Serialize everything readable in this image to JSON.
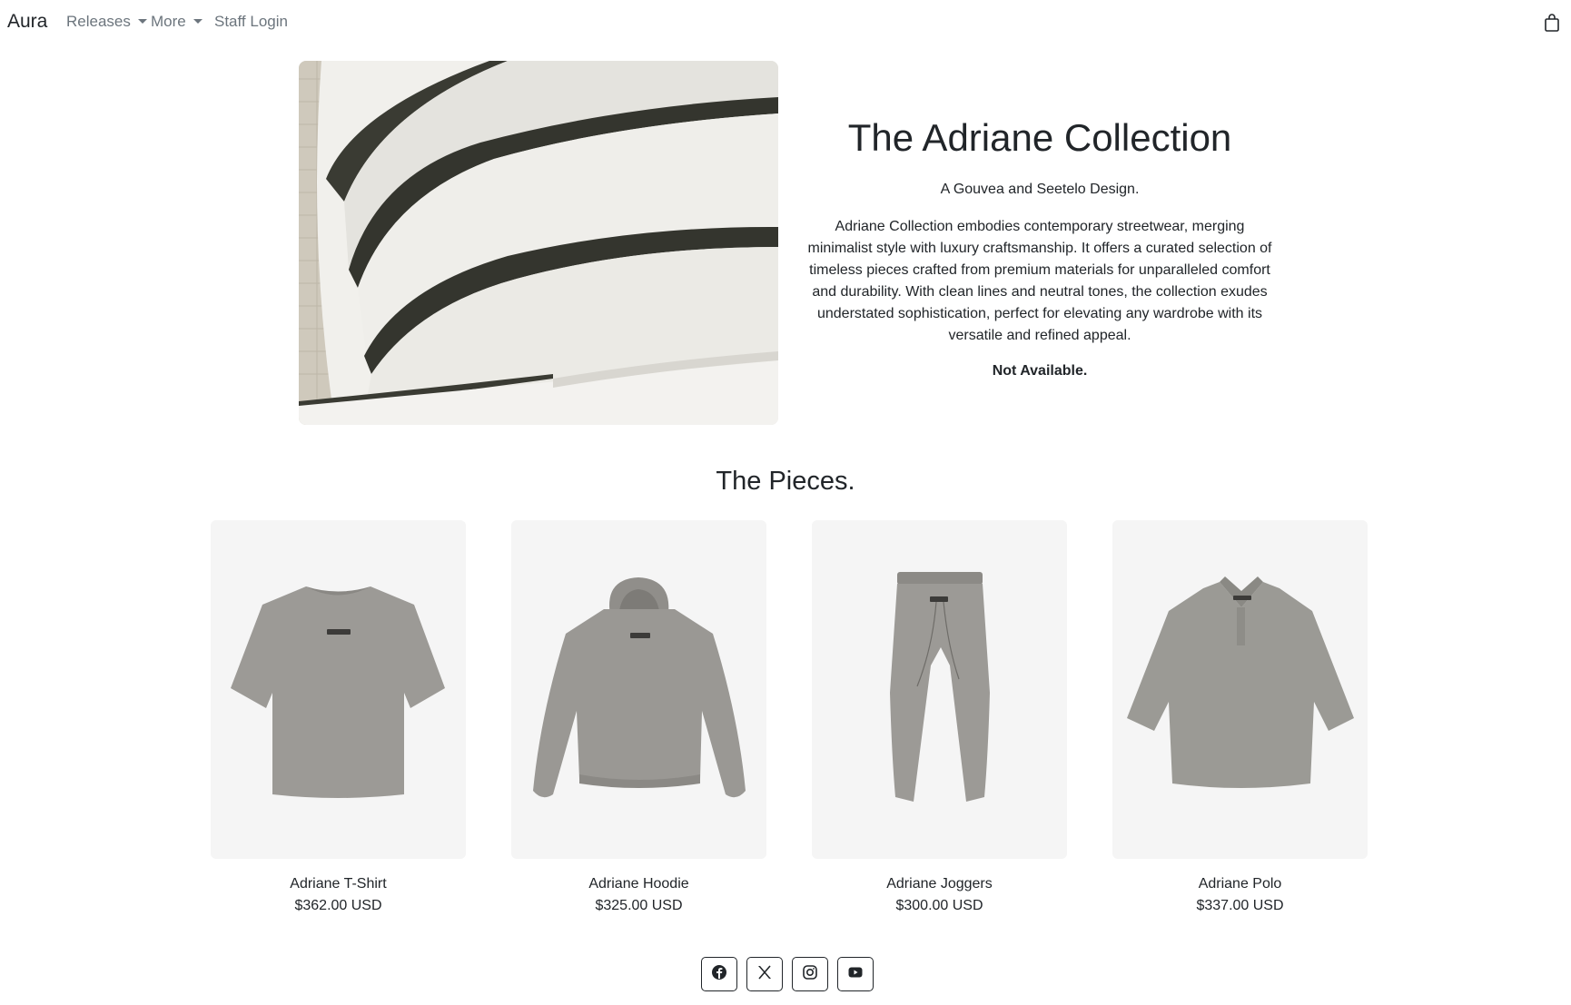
{
  "navbar": {
    "brand": "Aura",
    "links": [
      {
        "label": "Releases",
        "dropdown": true
      },
      {
        "label": "More",
        "dropdown": true
      },
      {
        "label": "Staff Login",
        "dropdown": false
      }
    ],
    "cart_icon": "shopping-bag-icon"
  },
  "hero": {
    "image": "spiral-building-photo",
    "title": "The Adriane Collection",
    "subtitle": "A Gouvea and Seetelo Design.",
    "description": "Adriane Collection embodies contemporary streetwear, merging minimalist style with luxury craftsmanship. It offers a curated selection of timeless pieces crafted from premium materials for unparalleled comfort and durability. With clean lines and neutral tones, the collection exudes understated sophistication, perfect for elevating any wardrobe with its versatile and refined appeal.",
    "status": "Not Available."
  },
  "pieces": {
    "title": "The Pieces.",
    "items": [
      {
        "name": "Adriane T-Shirt",
        "price": "$362.00 USD",
        "image": "t-shirt"
      },
      {
        "name": "Adriane Hoodie",
        "price": "$325.00 USD",
        "image": "hoodie"
      },
      {
        "name": "Adriane Joggers",
        "price": "$300.00 USD",
        "image": "joggers"
      },
      {
        "name": "Adriane Polo",
        "price": "$337.00 USD",
        "image": "polo"
      }
    ]
  },
  "social": [
    "facebook-icon",
    "x-icon",
    "instagram-icon",
    "youtube-icon"
  ],
  "colors": {
    "text": "#212529",
    "muted": "#6c757d",
    "garment": "#9c9a96",
    "card_bg": "#f5f5f5"
  }
}
